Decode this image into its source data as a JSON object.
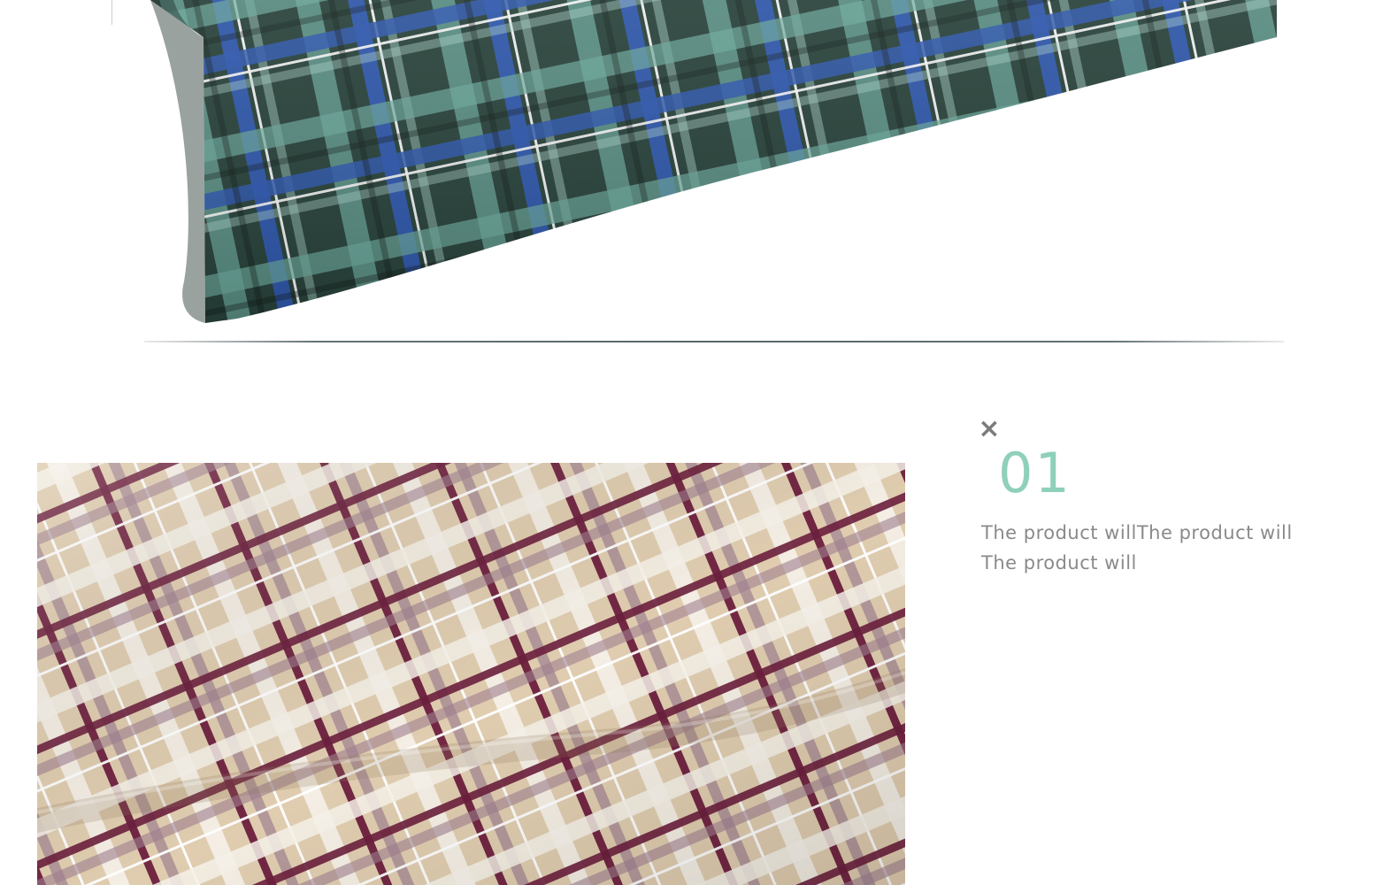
{
  "icons": {
    "close": "close-icon"
  },
  "colors": {
    "accent_number": "#8fd0bb",
    "body_text": "#8a8a8a",
    "close_icon": "#7b7b7b",
    "green_plaid_base": "#2f5b52",
    "blue_stripe": "#2c4fa8",
    "beige_plaid_base": "#d9c2a2",
    "maroon_stripe": "#6f1f3c"
  },
  "feature": {
    "close_label": "×",
    "number": "01",
    "text_line_1": "The product willThe product will",
    "text_line_2": "The product will"
  }
}
